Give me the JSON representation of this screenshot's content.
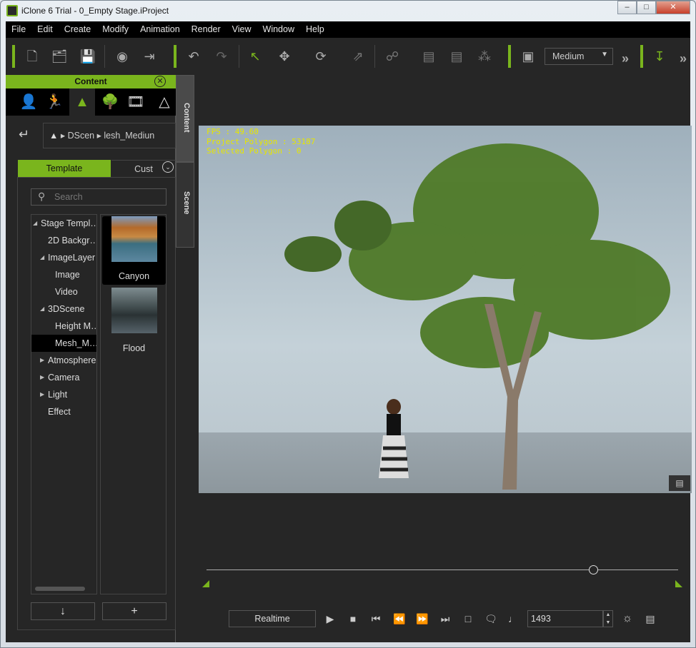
{
  "window": {
    "title": "iClone 6 Trial - 0_Empty Stage.iProject",
    "minimize": "–",
    "maximize": "□",
    "close": "✕"
  },
  "menu": [
    "File",
    "Edit",
    "Create",
    "Modify",
    "Animation",
    "Render",
    "View",
    "Window",
    "Help"
  ],
  "toolbar": {
    "quality": "Medium",
    "more": "»",
    "accent": "#7ab51d"
  },
  "panel": {
    "title": "Content",
    "vertical_tabs": [
      "Content",
      "Scene"
    ],
    "breadcrumb": [
      "DScen",
      "lesh_Mediun"
    ],
    "tabs": [
      "Template",
      "Cust"
    ],
    "search_placeholder": "Search",
    "tree": [
      {
        "label": "Stage Templ…",
        "level": 0,
        "state": "expanded"
      },
      {
        "label": "2D Backgr…",
        "level": 1
      },
      {
        "label": "ImageLayer",
        "level": 1,
        "state": "expanded"
      },
      {
        "label": "Image",
        "level": 2
      },
      {
        "label": "Video",
        "level": 2
      },
      {
        "label": "3DScene",
        "level": 1,
        "state": "expanded"
      },
      {
        "label": "Height M…",
        "level": 2
      },
      {
        "label": "Mesh_M…",
        "level": 2,
        "selected": true
      },
      {
        "label": "Atmosphere",
        "level": 1,
        "state": "collapsed"
      },
      {
        "label": "Camera",
        "level": 1,
        "state": "collapsed"
      },
      {
        "label": "Light",
        "level": 1,
        "state": "collapsed"
      },
      {
        "label": "Effect",
        "level": 1
      }
    ],
    "thumbnails": [
      {
        "label": "Canyon",
        "selected": true
      },
      {
        "label": "Flood"
      }
    ]
  },
  "viewport": {
    "fps": "FPS : 49.60",
    "project_polygon": "Project Polygon : 53187",
    "selected_polygon": "Selected Polygon : 0"
  },
  "timeline": {
    "position_fraction": 0.82
  },
  "playback": {
    "mode": "Realtime",
    "frame": "1493"
  }
}
